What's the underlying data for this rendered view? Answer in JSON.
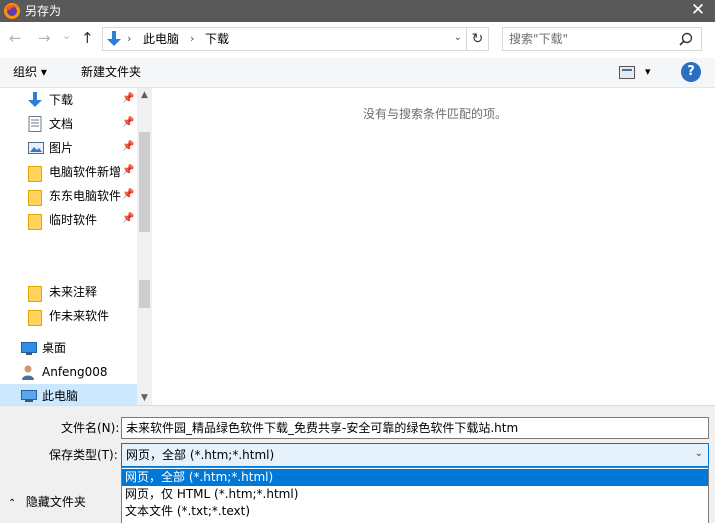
{
  "window": {
    "title": "另存为",
    "close_glyph": "✕"
  },
  "nav": {
    "back_glyph": "←",
    "forward_glyph": "→",
    "history_glyph": "⌄",
    "up_glyph": "↑",
    "breadcrumbs": [
      "此电脑",
      "下载"
    ],
    "breadcrumb_sep": "›",
    "refresh_glyph": "↻",
    "search_placeholder": "搜索\"下载\""
  },
  "toolbar": {
    "organize_label": "组织 ▾",
    "new_folder_label": "新建文件夹",
    "view_dropdown_glyph": "▾",
    "help_glyph": "?"
  },
  "sidebar": {
    "items": [
      {
        "label": "下载",
        "icon": "download-arrow-icon",
        "pinned": true
      },
      {
        "label": "文档",
        "icon": "document-icon",
        "pinned": true
      },
      {
        "label": "图片",
        "icon": "picture-icon",
        "pinned": true
      },
      {
        "label": "电脑软件新增",
        "icon": "folder-icon",
        "pinned": true
      },
      {
        "label": "东东电脑软件",
        "icon": "folder-icon",
        "pinned": true
      },
      {
        "label": "临时软件",
        "icon": "folder-icon",
        "pinned": true
      },
      {
        "label": "未来注释",
        "icon": "folder-icon",
        "pinned": false
      },
      {
        "label": "作未来软件",
        "icon": "folder-icon",
        "pinned": false
      }
    ],
    "roots": [
      {
        "label": "桌面",
        "icon": "desktop-icon"
      },
      {
        "label": "Anfeng008",
        "icon": "user-icon"
      },
      {
        "label": "此电脑",
        "icon": "computer-icon",
        "selected": true
      }
    ],
    "pin_glyph": "📌"
  },
  "main": {
    "empty_message": "没有与搜索条件匹配的项。"
  },
  "form": {
    "filename_label": "文件名(N):",
    "filename_value": "未来软件园_精品绿色软件下载_免费共享-安全可靠的绿色软件下载站.htm",
    "filetype_label": "保存类型(T):",
    "filetype_value": "网页，全部 (*.htm;*.html)",
    "filetype_options": [
      "网页，全部 (*.htm;*.html)",
      "网页，仅 HTML (*.htm;*.html)",
      "文本文件 (*.txt;*.text)"
    ],
    "dropdown_glyph": "⌄",
    "hide_folders_label": "隐藏文件夹",
    "hide_folders_glyph": "⌃"
  },
  "colors": {
    "titlebar": "#595959",
    "accent": "#0078d7",
    "selection": "#cce8ff"
  }
}
